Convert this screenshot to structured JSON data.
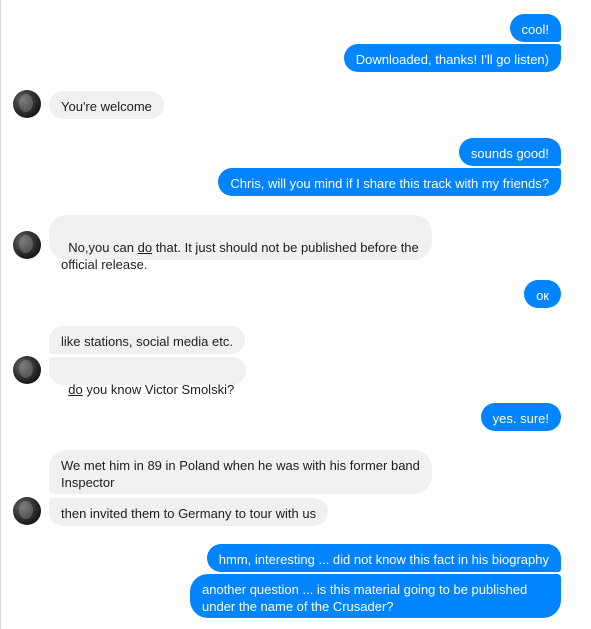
{
  "conversation": {
    "messages": [
      {
        "sender": "me",
        "text": "cool!"
      },
      {
        "sender": "me",
        "text": "Downloaded, thanks! I'll go listen)"
      },
      {
        "sender": "them",
        "text": "You're welcome"
      },
      {
        "sender": "me",
        "text": "sounds good!"
      },
      {
        "sender": "me",
        "text": "Chris, will you mind if I share this track with my friends?"
      },
      {
        "sender": "them",
        "pre": "No,you can ",
        "underline": "do",
        "post": " that. It just should not be published before the official release."
      },
      {
        "sender": "me",
        "text": "ок"
      },
      {
        "sender": "them",
        "text": "like stations, social media etc."
      },
      {
        "sender": "them",
        "underline": "do",
        "post": " you know Victor Smolski?"
      },
      {
        "sender": "me",
        "text": "yes. sure!"
      },
      {
        "sender": "them",
        "text": "We met him in 89 in Poland when he was with his former band  Inspector"
      },
      {
        "sender": "them",
        "text": "then invited them to Germany to tour with us"
      },
      {
        "sender": "me",
        "text": "hmm, interesting ... did not know this fact in his biography"
      },
      {
        "sender": "me",
        "text": "another question ... is this material going to be published under the name of the Crusader?"
      }
    ]
  },
  "colors": {
    "outgoing_bubble": "#0084ff",
    "incoming_bubble": "#f1f0f0"
  },
  "icons": {
    "avatar": "contact-avatar-icon"
  }
}
